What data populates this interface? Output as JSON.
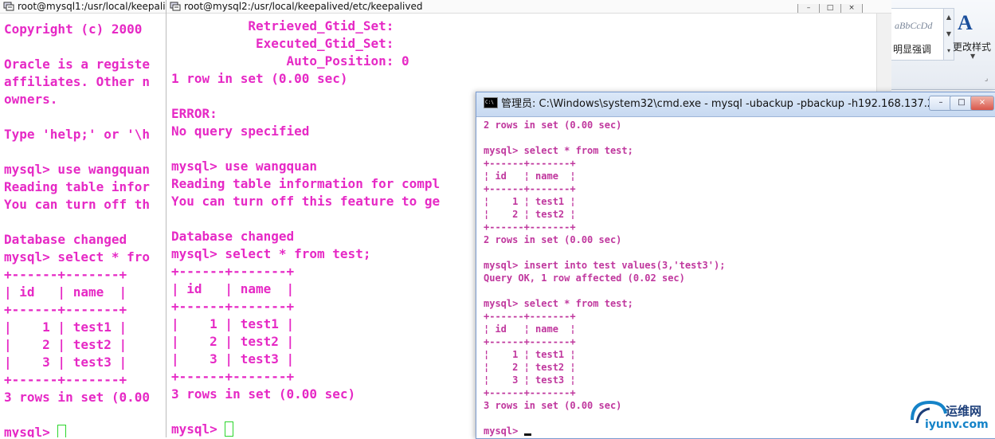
{
  "ribbon": {
    "style_sample": "aBbCcDd",
    "style_name": "明显强调",
    "change_styles_label": "更改样式"
  },
  "win1": {
    "title": "root@mysql1:/usr/local/keepali",
    "lines": [
      "Copyright (c) 2000",
      "",
      "Oracle is a registe",
      "affiliates. Other n",
      "owners.",
      "",
      "Type 'help;' or '\\h",
      "",
      "mysql> use wangquan",
      "Reading table infor",
      "You can turn off th",
      "",
      "Database changed",
      "mysql> select * fro",
      "+------+-------+",
      "| id   | name  |",
      "+------+-------+",
      "|    1 | test1 |",
      "|    2 | test2 |",
      "|    3 | test3 |",
      "+------+-------+",
      "3 rows in set (0.00",
      ""
    ],
    "prompt": "mysql> "
  },
  "win2": {
    "title": "root@mysql2:/usr/local/keepalived/etc/keepalived",
    "lines": [
      "          Retrieved_Gtid_Set:",
      "           Executed_Gtid_Set:",
      "               Auto_Position: 0",
      "1 row in set (0.00 sec)",
      "",
      "ERROR:",
      "No query specified",
      "",
      "mysql> use wangquan",
      "Reading table information for compl",
      "You can turn off this feature to ge",
      "",
      "Database changed",
      "mysql> select * from test;",
      "+------+-------+",
      "| id   | name  |",
      "+------+-------+",
      "|    1 | test1 |",
      "|    2 | test2 |",
      "|    3 | test3 |",
      "+------+-------+",
      "3 rows in set (0.00 sec)",
      ""
    ],
    "prompt": "mysql> "
  },
  "win3": {
    "title": "管理员: C:\\Windows\\system32\\cmd.exe - mysql  -ubackup -pbackup -h192.168.137.2",
    "lines": [
      "2 rows in set (0.00 sec)",
      "",
      "mysql> select * from test;",
      "+------+-------+",
      "¦ id   ¦ name  ¦",
      "+------+-------+",
      "¦    1 ¦ test1 ¦",
      "¦    2 ¦ test2 ¦",
      "+------+-------+",
      "2 rows in set (0.00 sec)",
      "",
      "mysql> insert into test values(3,'test3');",
      "Query OK, 1 row affected (0.02 sec)",
      "",
      "mysql> select * from test;",
      "+------+-------+",
      "¦ id   ¦ name  ¦",
      "+------+-------+",
      "¦    1 ¦ test1 ¦",
      "¦    2 ¦ test2 ¦",
      "¦    3 ¦ test3 ¦",
      "+------+-------+",
      "3 rows in set (0.00 sec)",
      ""
    ],
    "prompt": "mysql> "
  },
  "watermark": {
    "text_cn": "运维网",
    "text_en": "iyunv.com"
  }
}
